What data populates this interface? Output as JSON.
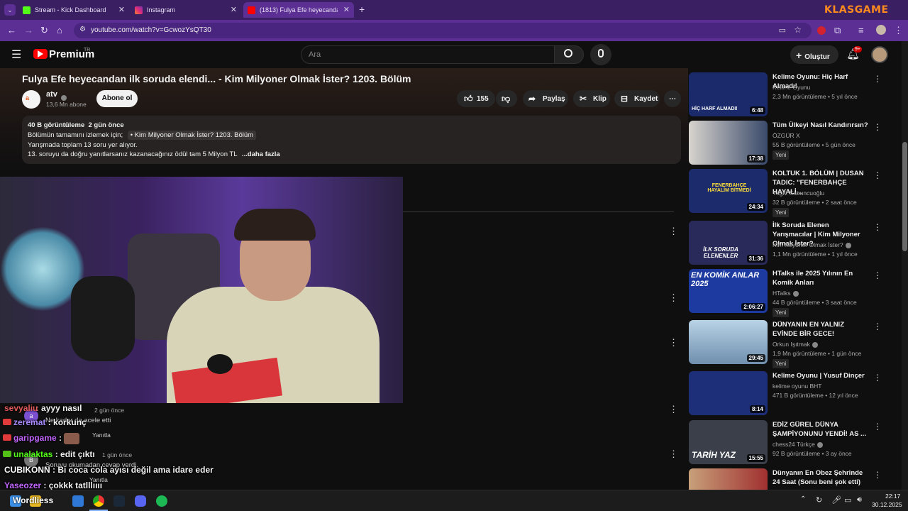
{
  "browser": {
    "tabs": [
      {
        "label": "Stream - Kick Dashboard",
        "color": "#53fc18"
      },
      {
        "label": "Instagram",
        "color": "#e1306c"
      },
      {
        "label": "(1813) Fulya Efe heyecandan ilk",
        "color": "#ff0000"
      }
    ],
    "url": "youtube.com/watch?v=GcwozYsQT30",
    "overlay_logo": "KLASGAME"
  },
  "youtube": {
    "logo": "Premium",
    "logo_sup": "TR",
    "search_placeholder": "Ara",
    "create_label": "Oluştur",
    "notif_count": "9+"
  },
  "video": {
    "title": "Fulya Efe heyecandan ilk soruda elendi... - Kim Milyoner Olmak İster? 1203. Bölüm",
    "channel": "atv",
    "subs": "13,6 Mn abone",
    "subscribe": "Abone ol",
    "likes": "155",
    "share": "Paylaş",
    "clip": "Klip",
    "save": "Kaydet",
    "desc_stats": "40 B görüntüleme  2 gün önce",
    "desc_line1_prefix": "Bölümün tamamını izlemek için;",
    "desc_link": "• Kim Milyoner Olmak İster? 1203. Bölüm",
    "desc_line2": "Yarışmada toplam 13 soru yer alıyor.",
    "desc_line3": "13. soruyu da doğru yanıtlarsanız kazanacağınız ödül tam 5 Milyon TL",
    "desc_more": "...daha fazla"
  },
  "chat": [
    {
      "user": "sevyaliu",
      "text": "ayyy nasıl",
      "color": "#e05a5a"
    },
    {
      "user": "zeremat",
      "text": "korkunç",
      "color": "#a98cff"
    },
    {
      "user": "garipgame",
      "text": "",
      "color": "#c266ff"
    },
    {
      "user": "unalaktas",
      "text": "edit çıktı",
      "color": "#53fc18"
    },
    {
      "user": "CUBIKONN",
      "text": "Bi coca cola ayısı değil ama idare eder",
      "color": "#ffffff"
    },
    {
      "user": "Yaseozer",
      "text": "çokkk tatlllıııı",
      "color": "#c266ff"
    }
  ],
  "comments_bg": [
    {
      "text": "2 gün önce",
      "reply": "Yanıtla"
    },
    {
      "text": "Ne kadar da acele etti",
      "reply": "Yanıtla"
    },
    {
      "text": "1 gün önce",
      "reply": "Yanıtla"
    },
    {
      "text": "Soruyu okumadan cevap verdi.",
      "reply": "Yanıtla"
    }
  ],
  "recommended": [
    {
      "title": "Kelime Oyunu: Hiç Harf Almadı!",
      "channel": "Kelime Oyunu",
      "meta": "2,3 Mn görüntüleme • 5 yıl önce",
      "duration": "6:48",
      "badge": "",
      "thumb": "#1a2a6a",
      "thumb_text": "HİÇ HARF ALMADI!",
      "verified": false
    },
    {
      "title": "Tüm Ülkeyi Nasıl Kandırırsın?",
      "channel": "ÖZGÜR X",
      "meta": "55 B görüntüleme • 5 gün önce",
      "duration": "17:38",
      "badge": "Yeni",
      "thumb": "#3a4a5a",
      "thumb_text": "",
      "verified": false
    },
    {
      "title": "KOLTUK 1. BÖLÜM | DUSAN TADIC: \"FENERBAHÇE HAYALİ...",
      "channel": "Yağız Sabuncuoğlu",
      "meta": "32 B görüntüleme • 2 saat önce",
      "duration": "24:34",
      "badge": "Yeni",
      "thumb": "#1b2b6b",
      "thumb_text": "FENERBAHÇE HAYALİM BİTMEDİ",
      "verified": false
    },
    {
      "title": "İlk Soruda Elenen Yarışmacılar | Kim Milyoner Olmak İster?",
      "channel": "Kim Milyoner Olmak İster?",
      "meta": "1,1 Mn görüntüleme • 1 yıl önce",
      "duration": "31:36",
      "badge": "",
      "thumb": "#2a2a5a",
      "thumb_text": "İLK SORUDA ELENENLER",
      "verified": true
    },
    {
      "title": "HTalks ile 2025 Yılının En Komik Anları",
      "channel": "HTalks",
      "meta": "44 B görüntüleme • 3 saat önce",
      "duration": "2:06:27",
      "badge": "Yeni",
      "thumb": "#1c3aa0",
      "thumb_text": "EN KOMİK ANLAR 2025",
      "verified": true
    },
    {
      "title": "DÜNYANIN EN YALNIZ EVİNDE BİR GECE!",
      "channel": "Orkun Işıtmak",
      "meta": "1,9 Mn görüntüleme • 1 gün önce",
      "duration": "29:45",
      "badge": "Yeni",
      "thumb": "#8fb3cf",
      "thumb_text": "",
      "verified": true
    },
    {
      "title": "Kelime Oyunu | Yusuf Dinçer",
      "channel": "kelime oyunu BHT",
      "meta": "471 B görüntüleme • 12 yıl önce",
      "duration": "8:14",
      "badge": "",
      "thumb": "#1e2f7a",
      "thumb_text": "",
      "verified": false
    },
    {
      "title": "EDİZ GÜREL DÜNYA ŞAMPİYONUNU YENDİ! AS ...",
      "channel": "chess24 Türkçe",
      "meta": "92 B görüntüleme • 3 ay önce",
      "duration": "15:55",
      "badge": "",
      "thumb": "#3a3f4a",
      "thumb_text": "TARİH YAZ",
      "verified": true
    },
    {
      "title": "Dünyanın En Obez Şehrinde 24 Saat (Sonu beni şok etti)",
      "channel": "",
      "meta": "",
      "duration": "",
      "badge": "",
      "thumb": "#6a4a3a",
      "thumb_text": "",
      "verified": false
    }
  ],
  "taskbar": {
    "time": "22:17",
    "date": "30.12.2025",
    "overlay_text": "Wordliess"
  }
}
